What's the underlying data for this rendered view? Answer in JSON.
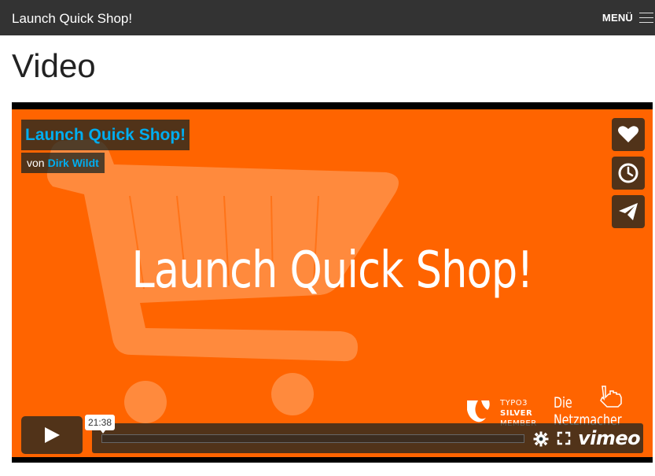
{
  "navbar": {
    "brand": "Launch Quick Shop!",
    "menu_label": "MENÜ",
    "menu_icon": "hamburger-icon"
  },
  "page": {
    "title": "Video"
  },
  "player": {
    "title": "Launch Quick Shop!",
    "byline_prefix": "von",
    "author": "Dirk Wildt",
    "video_headline": "Launch Quick Shop!",
    "time_tooltip": "21:38",
    "sidebar_icons": [
      "heart-icon",
      "clock-icon",
      "paper-plane-icon"
    ],
    "control_icons": [
      "play-icon",
      "settings-icon",
      "fullscreen-icon"
    ],
    "vimeo_logo": "vimeo",
    "logos": {
      "typo3_lines": [
        "TYPO3",
        "SILVER",
        "MEMBER"
      ],
      "netzmacher_lines": [
        "Die",
        "Netzmacher"
      ]
    }
  },
  "colors": {
    "navbar_bg": "#333333",
    "video_bg": "#ff6400",
    "accent": "#00adef",
    "overlay": "#172322"
  }
}
